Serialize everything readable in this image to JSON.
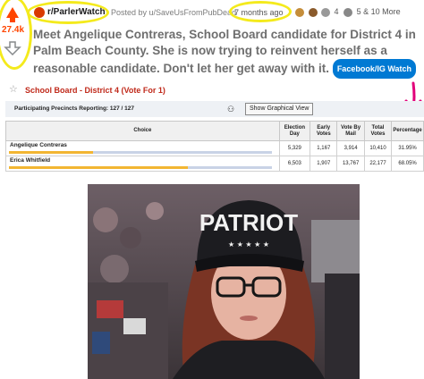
{
  "vote": {
    "score": "27.4k",
    "up_icon": "upvote-arrow-icon",
    "down_icon": "downvote-arrow-icon"
  },
  "header": {
    "subreddit": "r/ParlerWatch",
    "posted_by": "Posted by u/SaveUsFromPubDead",
    "time": "7 months ago",
    "award_count_1": "4",
    "award_count_2": "5",
    "more_awards": "& 10 More"
  },
  "post": {
    "title": "Meet Angelique Contreras, School Board candidate for District 4 in Palm Beach County. She is now trying to reinvent herself as a reasonable candidate. Don't let her get away with it.",
    "flair": "Facebook/IG Watch"
  },
  "election": {
    "title": "School Board - District 4 (Vote For 1)",
    "precincts": "Participating Precincts Reporting: 127 / 127",
    "graph_button": "Show Graphical View",
    "columns": [
      "Choice",
      "Election Day",
      "Early Votes",
      "Vote By Mail",
      "Total Votes",
      "Percentage"
    ],
    "candidates": [
      {
        "name": "Angelique Contreras",
        "election_day": "5,329",
        "early": "1,167",
        "mail": "3,914",
        "total": "10,410",
        "pct": "31.95%",
        "fraction": 0.3195
      },
      {
        "name": "Erica Whitfield",
        "election_day": "6,503",
        "early": "1,907",
        "mail": "13,767",
        "total": "22,177",
        "pct": "68.05%",
        "fraction": 0.6805
      }
    ]
  },
  "photo": {
    "cap_text": "PATRIOT"
  },
  "colors": {
    "upvote": "#ff4500",
    "highlight": "#f4ea1c",
    "flair": "#0079d3",
    "election_title": "#c02a1b",
    "bar": "#f2b632",
    "pink_arrow": "#e2007a"
  }
}
